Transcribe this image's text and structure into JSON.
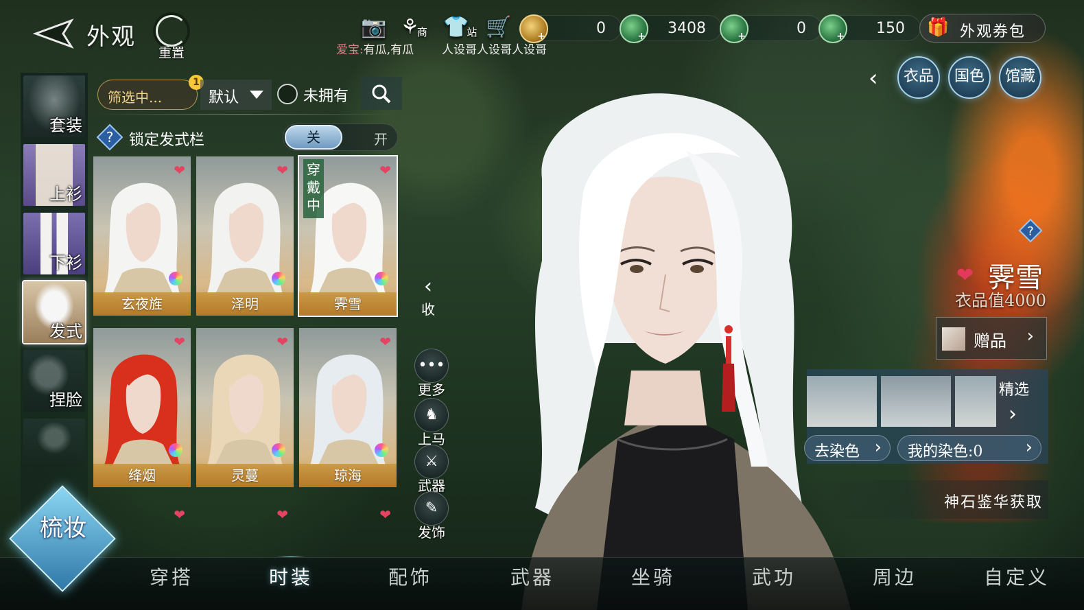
{
  "header": {
    "title": "外观",
    "reset_label": "重置",
    "shop_tag": "商",
    "station_tag": "站",
    "aibao_prefix": "爱宝:",
    "aibao_text": "有瓜,有瓜",
    "who_text": "人设哥人设哥人设哥"
  },
  "currencies": [
    {
      "name": "jade-gold",
      "value": "0"
    },
    {
      "name": "jade-green",
      "value": "3408"
    },
    {
      "name": "jade-green-2",
      "value": "0"
    },
    {
      "name": "jade-green-3",
      "value": "150"
    }
  ],
  "coupon_label": "外观券包",
  "sidebar": {
    "items": [
      {
        "label": "套装"
      },
      {
        "label": "上衫"
      },
      {
        "label": "下衫"
      },
      {
        "label": "发式",
        "selected": true
      },
      {
        "label": "捏脸"
      }
    ]
  },
  "filter": {
    "filter_label": "筛选中...",
    "filter_badge": "1",
    "sort_label": "默认",
    "unowned_label": "未拥有"
  },
  "lock": {
    "label": "锁定发式栏",
    "off_label": "关",
    "on_label": "开"
  },
  "hairstyles": [
    {
      "name": "玄夜旌",
      "hair": "#f4f4f2",
      "wearing": false
    },
    {
      "name": "泽明",
      "hair": "#f2f2f0",
      "wearing": false
    },
    {
      "name": "霁雪",
      "hair": "#f7f7f5",
      "wearing": true,
      "wearing_tag": "穿戴中"
    },
    {
      "name": "绛烟",
      "hair": "#d8301c",
      "wearing": false
    },
    {
      "name": "灵蔓",
      "hair": "#ead7b8",
      "wearing": false
    },
    {
      "name": "琼海",
      "hair": "#e6ecf0",
      "wearing": false
    }
  ],
  "mid_menu": {
    "collapse": "收",
    "more": "更多",
    "mount": "上马",
    "weapon": "武器",
    "hair_accessory": "发饰"
  },
  "right_panel": {
    "tabs": [
      "衣品",
      "国色",
      "馆藏"
    ],
    "item_name": "霁雪",
    "item_value": "衣品值4000",
    "gift_label": "赠品",
    "featured_label": "精选",
    "go_dye": "去染色",
    "my_dye": "我的染色:0",
    "source": "神石鉴华获取"
  },
  "bottom_tabs": [
    {
      "label": "穿搭"
    },
    {
      "label": "时装",
      "selected": true
    },
    {
      "label": "配饰"
    },
    {
      "label": "武器"
    },
    {
      "label": "坐骑"
    },
    {
      "label": "武功"
    },
    {
      "label": "周边"
    },
    {
      "label": "自定义"
    }
  ],
  "makeup_label": "梳妆",
  "colors": {
    "accent": "#f3d38b",
    "heart": "#e24461",
    "card_name_bg": "#c4893a",
    "tab_glow": "#a9d4ea"
  }
}
